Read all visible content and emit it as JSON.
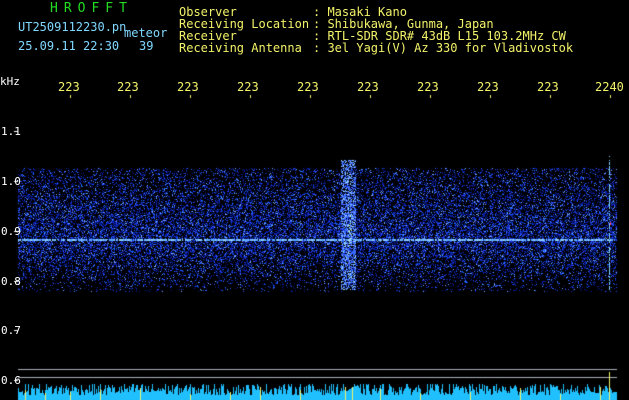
{
  "header": {
    "brand": "HROFFT",
    "filename": "UT2509112230.pn",
    "tag": "meteor",
    "datetime": "25.09.11 22:30",
    "count": "39",
    "info": [
      {
        "label": "Observer",
        "value": ": Masaki Kano"
      },
      {
        "label": "Receiving Location",
        "value": ": Shibukawa, Gunma, Japan"
      },
      {
        "label": "Receiver",
        "value": ": RTL-SDR SDR# 43dB L15 103.2MHz CW"
      },
      {
        "label": "Receiving Antenna",
        "value": ": 3el Yagi(V) Az 330 for Vladivostok"
      }
    ]
  },
  "axis": {
    "unit": "kHz",
    "time_ticks": [
      "223",
      "223",
      "223",
      "223",
      "223",
      "223",
      "223",
      "223",
      "223",
      "2240"
    ],
    "freq_labels": [
      "1.1",
      "1.0",
      "0.9",
      "0.8",
      "0.7",
      "0.6"
    ]
  },
  "colors": {
    "background": "#000000",
    "noise": "#1a3cff",
    "carrier": "#7fc8ff",
    "header_yellow": "#f2f26a",
    "header_cyan": "#7fd8ff",
    "brand_green": "#22dd22",
    "level_bars": "#20c0ff"
  }
}
